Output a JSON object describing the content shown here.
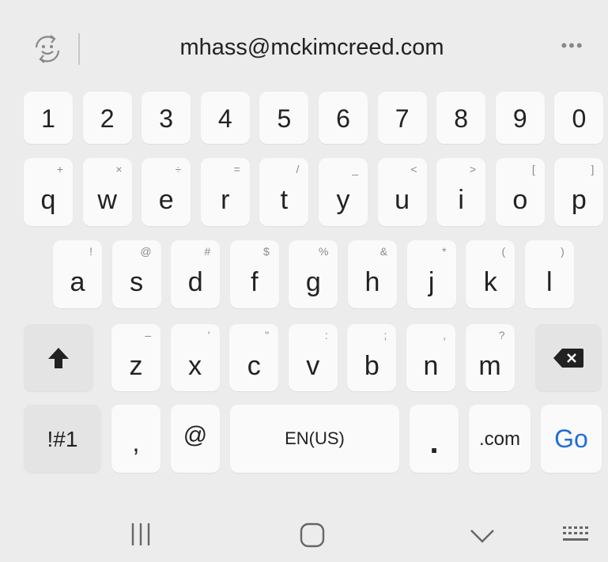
{
  "suggestion_bar": {
    "suggestion_text": "mhass@mckimcreed.com",
    "more_label": "•••",
    "left_icon": "emoji-icon"
  },
  "keyboard": {
    "number_row": [
      "1",
      "2",
      "3",
      "4",
      "5",
      "6",
      "7",
      "8",
      "9",
      "0"
    ],
    "row1": [
      {
        "char": "q",
        "hint": "+"
      },
      {
        "char": "w",
        "hint": "×"
      },
      {
        "char": "e",
        "hint": "÷"
      },
      {
        "char": "r",
        "hint": "="
      },
      {
        "char": "t",
        "hint": "/"
      },
      {
        "char": "y",
        "hint": "_"
      },
      {
        "char": "u",
        "hint": "<"
      },
      {
        "char": "i",
        "hint": ">"
      },
      {
        "char": "o",
        "hint": "["
      },
      {
        "char": "p",
        "hint": "]"
      }
    ],
    "row2": [
      {
        "char": "a",
        "hint": "!"
      },
      {
        "char": "s",
        "hint": "@"
      },
      {
        "char": "d",
        "hint": "#"
      },
      {
        "char": "f",
        "hint": "$"
      },
      {
        "char": "g",
        "hint": "%"
      },
      {
        "char": "h",
        "hint": "&"
      },
      {
        "char": "j",
        "hint": "*"
      },
      {
        "char": "k",
        "hint": "("
      },
      {
        "char": "l",
        "hint": ")"
      }
    ],
    "row3": [
      {
        "char": "z",
        "hint": "–"
      },
      {
        "char": "x",
        "hint": "'"
      },
      {
        "char": "c",
        "hint": "\""
      },
      {
        "char": "v",
        "hint": ":"
      },
      {
        "char": "b",
        "hint": ";"
      },
      {
        "char": "n",
        "hint": ","
      },
      {
        "char": "m",
        "hint": "?"
      }
    ],
    "bottom_row": {
      "symbols_label": "!#1",
      "comma_label": ",",
      "at_label": "@",
      "space_label": "EN(US)",
      "period_label": ".",
      "dotcom_label": ".com",
      "go_label": "Go"
    },
    "shift_icon": "shift-arrow-icon",
    "backspace_icon": "backspace-icon"
  },
  "colors": {
    "background": "#ececec",
    "key": "#fafafa",
    "go_text": "#1e6fd9"
  },
  "navigation": {
    "icons": [
      "recent-apps-icon",
      "home-icon",
      "back-chevron-icon",
      "keyboard-icon"
    ]
  }
}
